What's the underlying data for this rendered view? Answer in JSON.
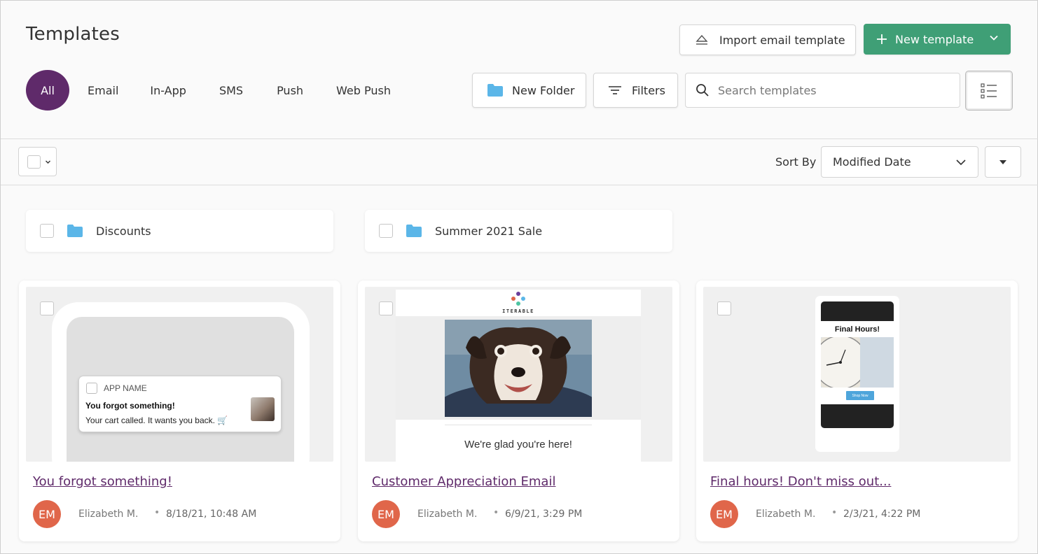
{
  "header": {
    "title": "Templates",
    "import_label": "Import email template",
    "new_label": "New template"
  },
  "tabs": [
    "All",
    "Email",
    "In-App",
    "SMS",
    "Push",
    "Web Push"
  ],
  "toolbar": {
    "new_folder_label": "New Folder",
    "filters_label": "Filters",
    "search_placeholder": "Search templates",
    "sort_label": "Sort By",
    "sort_value": "Modified Date"
  },
  "folders": [
    {
      "name": "Discounts"
    },
    {
      "name": "Summer 2021 Sale"
    }
  ],
  "templates": [
    {
      "title": "You forgot something!",
      "author": "Elizabeth M.",
      "initials": "EM",
      "date": "8/18/21, 10:48 AM",
      "preview": {
        "app_name": "APP NAME",
        "notif_title": "You forgot something!",
        "notif_body": "Your cart called. It wants you back. 🛒"
      }
    },
    {
      "title": "Customer Appreciation Email",
      "author": "Elizabeth M.",
      "initials": "EM",
      "date": "6/9/21, 3:29 PM",
      "preview": {
        "logo_text": "ITERABLE",
        "greeting": "We're glad you're here!"
      }
    },
    {
      "title": "Final hours! Don't miss out...",
      "author": "Elizabeth M.",
      "initials": "EM",
      "date": "2/3/21, 4:22 PM",
      "preview": {
        "headline": "Final Hours!",
        "cta": "Shop Now"
      }
    }
  ],
  "colors": {
    "brand_purple": "#5f2a6a",
    "primary_green": "#3f9f76",
    "folder_blue": "#5bb6e8",
    "avatar_orange": "#e0664a"
  },
  "icons": [
    "eject-upload-icon",
    "plus-icon",
    "chevron-down-icon",
    "folder-icon",
    "filter-lines-icon",
    "search-icon",
    "list-view-icon",
    "caret-down-icon"
  ]
}
